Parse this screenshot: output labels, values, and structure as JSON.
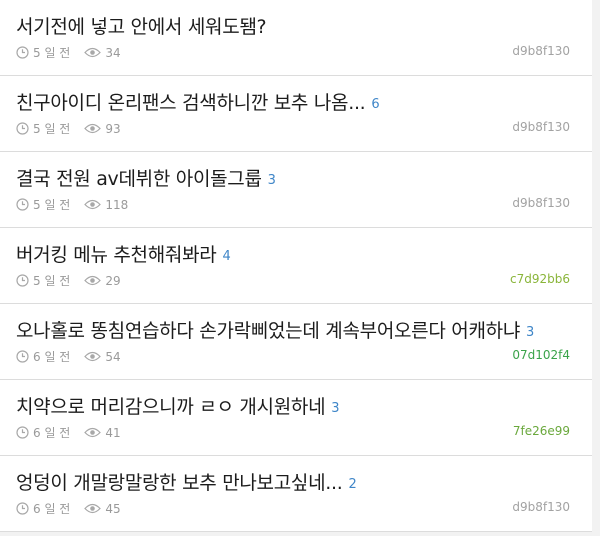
{
  "posts": [
    {
      "title": "서기전에 넣고 안에서 세워도됌?",
      "comment_count": "",
      "time": "5 일 전",
      "views": "34",
      "author": "d9b8f130",
      "author_color": "#a2a2a2"
    },
    {
      "title": "친구아이디 온리팬스 검색하니깐 보추 나옴...",
      "comment_count": "6",
      "time": "5 일 전",
      "views": "93",
      "author": "d9b8f130",
      "author_color": "#a2a2a2"
    },
    {
      "title": "결국 전원 av데뷔한 아이돌그룹",
      "comment_count": "3",
      "time": "5 일 전",
      "views": "118",
      "author": "d9b8f130",
      "author_color": "#a2a2a2"
    },
    {
      "title": "버거킹 메뉴 추천해줘봐라",
      "comment_count": "4",
      "time": "5 일 전",
      "views": "29",
      "author": "c7d92bb6",
      "author_color": "#8ab53a"
    },
    {
      "title": "오나홀로 똥침연습하다 손가락삐었는데 계속부어오른다 어캐하냐",
      "comment_count": "3",
      "time": "6 일 전",
      "views": "54",
      "author": "07d102f4",
      "author_color": "#3aa34a"
    },
    {
      "title": "치약으로 머리감으니까 ㄹㅇ 개시원하네",
      "comment_count": "3",
      "time": "6 일 전",
      "views": "41",
      "author": "7fe26e99",
      "author_color": "#6aa83c"
    },
    {
      "title": "엉덩이 개말랑말랑한 보추 만나보고싶네...",
      "comment_count": "2",
      "time": "6 일 전",
      "views": "45",
      "author": "d9b8f130",
      "author_color": "#a2a2a2"
    }
  ]
}
